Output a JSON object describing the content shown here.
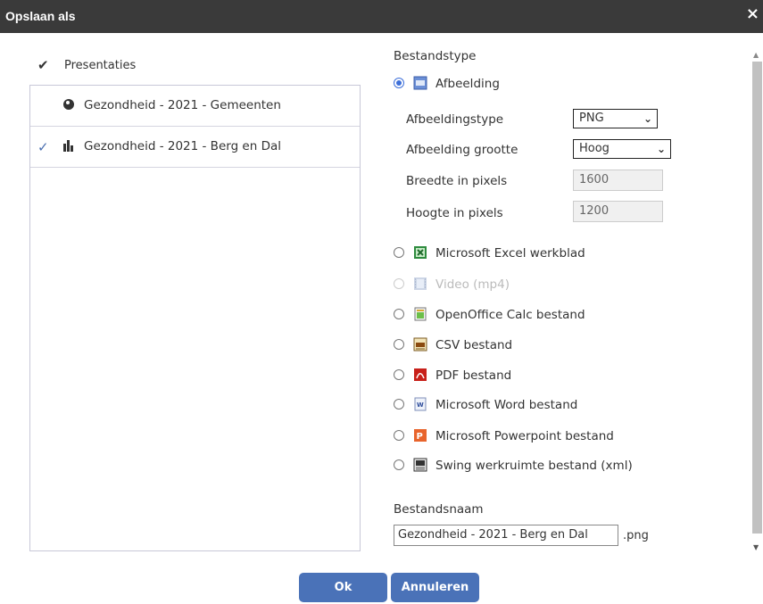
{
  "dialog": {
    "title": "Opslaan als",
    "close": "×"
  },
  "presentations": {
    "header": "Presentaties",
    "items": [
      {
        "label": "Gezondheid - 2021 - Gemeenten",
        "icon": "globe-icon",
        "checked": false
      },
      {
        "label": "Gezondheid - 2021 - Berg en Dal",
        "icon": "bar-chart-icon",
        "checked": true
      }
    ]
  },
  "filetype": {
    "heading": "Bestandstype",
    "image": {
      "label": "Afbeelding",
      "type_label": "Afbeeldingstype",
      "type_value": "PNG",
      "size_label": "Afbeelding grootte",
      "size_value": "Hoog",
      "width_label": "Breedte in pixels",
      "width_value": "1600",
      "height_label": "Hoogte in pixels",
      "height_value": "1200"
    },
    "options": [
      {
        "label": "Microsoft Excel werkblad",
        "icon": "excel-icon",
        "disabled": false
      },
      {
        "label": "Video (mp4)",
        "icon": "video-icon",
        "disabled": true
      },
      {
        "label": "OpenOffice Calc bestand",
        "icon": "calc-icon",
        "disabled": false
      },
      {
        "label": "CSV bestand",
        "icon": "csv-icon",
        "disabled": false
      },
      {
        "label": "PDF bestand",
        "icon": "pdf-icon",
        "disabled": false
      },
      {
        "label": "Microsoft Word bestand",
        "icon": "word-icon",
        "disabled": false
      },
      {
        "label": "Microsoft Powerpoint bestand",
        "icon": "powerpoint-icon",
        "disabled": false
      },
      {
        "label": "Swing werkruimte bestand (xml)",
        "icon": "xml-icon",
        "disabled": false
      }
    ]
  },
  "filename": {
    "label": "Bestandsnaam",
    "value": "Gezondheid - 2021 - Berg en Dal",
    "extension": ".png"
  },
  "buttons": {
    "ok": "Ok",
    "cancel": "Annuleren"
  },
  "colors": {
    "titlebar": "#3a3a3a",
    "button": "#4a72b8",
    "accent": "#3d6fd9"
  }
}
